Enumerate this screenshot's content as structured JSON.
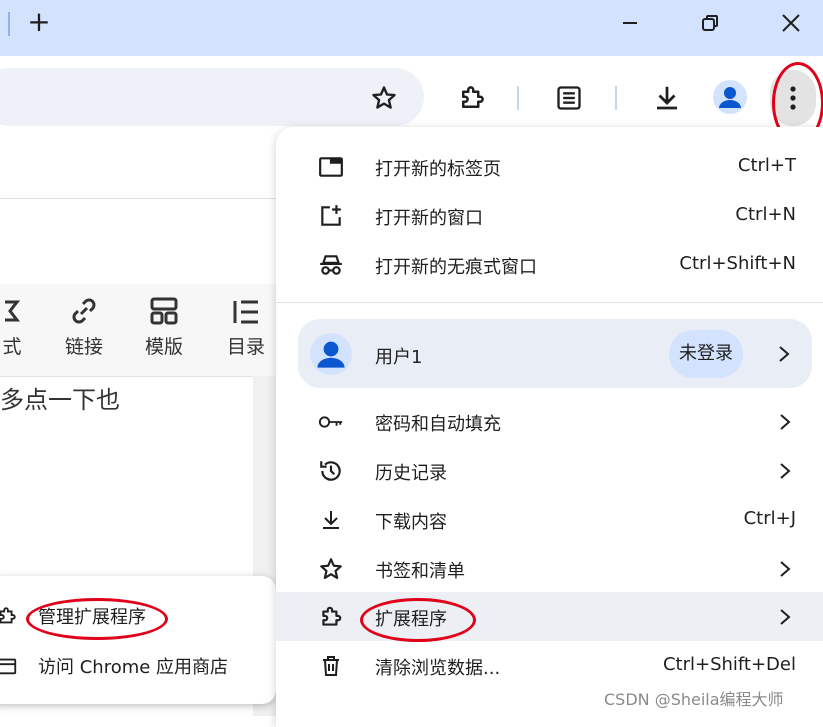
{
  "window": {
    "new_tab_symbol": "+"
  },
  "page": {
    "tools": [
      {
        "label": "式",
        "icon": "format-icon"
      },
      {
        "label": "链接",
        "icon": "link-icon"
      },
      {
        "label": "模版",
        "icon": "template-icon"
      },
      {
        "label": "目录",
        "icon": "toc-icon"
      }
    ],
    "body_text": "多点一下也"
  },
  "menu": {
    "items_top": [
      {
        "label": "打开新的标签页",
        "shortcut": "Ctrl+T",
        "icon": "new-tab-icon"
      },
      {
        "label": "打开新的窗口",
        "shortcut": "Ctrl+N",
        "icon": "new-window-icon"
      },
      {
        "label": "打开新的无痕式窗口",
        "shortcut": "Ctrl+Shift+N",
        "icon": "incognito-icon"
      }
    ],
    "profile": {
      "name": "用户1",
      "status": "未登录"
    },
    "items_bottom": [
      {
        "label": "密码和自动填充",
        "shortcut": "",
        "icon": "key-icon",
        "submenu": true
      },
      {
        "label": "历史记录",
        "shortcut": "",
        "icon": "history-icon",
        "submenu": true
      },
      {
        "label": "下载内容",
        "shortcut": "Ctrl+J",
        "icon": "download-icon",
        "submenu": false
      },
      {
        "label": "书签和清单",
        "shortcut": "",
        "icon": "star-icon",
        "submenu": true
      },
      {
        "label": "扩展程序",
        "shortcut": "",
        "icon": "puzzle-icon",
        "submenu": true
      },
      {
        "label": "清除浏览数据...",
        "shortcut": "Ctrl+Shift+Del",
        "icon": "trash-icon",
        "submenu": false
      }
    ]
  },
  "extensions_submenu": {
    "items": [
      {
        "label": "管理扩展程序",
        "icon": "puzzle-icon"
      },
      {
        "label": "访问 Chrome 应用商店",
        "icon": "store-icon"
      }
    ]
  },
  "watermark": "CSDN @Sheila编程大师",
  "colors": {
    "titlebar": "#d3e3fd",
    "accent": "#0b57d0",
    "annotation_red": "#e0001a"
  }
}
